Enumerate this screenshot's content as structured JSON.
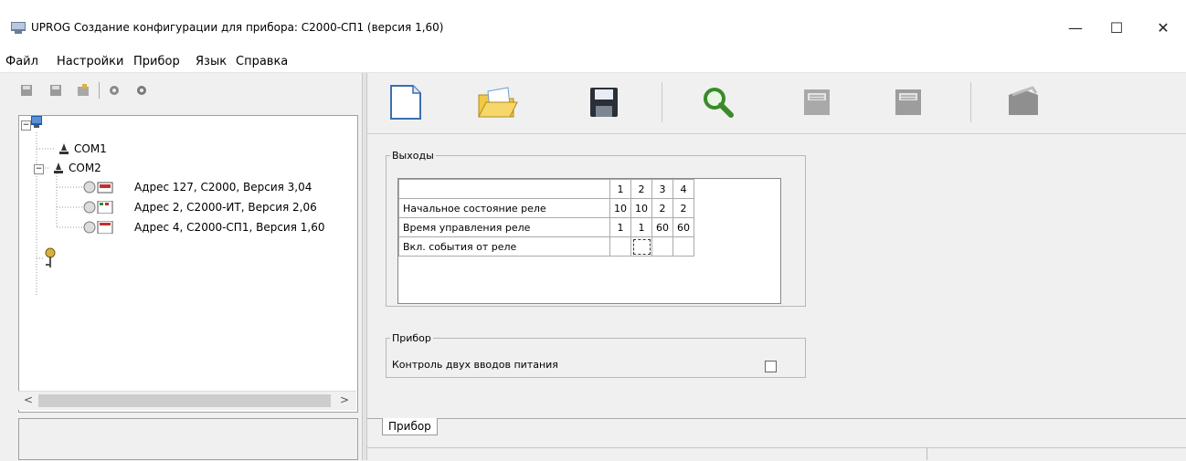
{
  "window": {
    "title": "UPROG  Создание конфигурации для прибора: С2000-СП1 (версия  1,60)",
    "minimize_glyph": "—",
    "maximize_glyph": "☐",
    "close_glyph": "✕"
  },
  "menu": [
    "Файл",
    "Настройки",
    "Прибор",
    "Язык",
    "Справка"
  ],
  "tree": {
    "items": [
      {
        "label": "COM1"
      },
      {
        "label": "COM2"
      },
      {
        "label": "Адрес 127, С2000, Версия 3,04"
      },
      {
        "label": "Адрес 2, С2000-ИТ, Версия 2,06"
      },
      {
        "label": "Адрес 4, С2000-СП1, Версия 1,60"
      }
    ],
    "expander_minus": "−",
    "scroll_left": "<",
    "scroll_right": ">"
  },
  "outputs": {
    "legend": "Выходы",
    "columns": [
      "1",
      "2",
      "3",
      "4"
    ],
    "rows": [
      {
        "label": "Начальное состояние реле",
        "values": [
          "10",
          "10",
          "2",
          "2"
        ]
      },
      {
        "label": "Время управления реле",
        "values": [
          "1",
          "1",
          "60",
          "60"
        ]
      },
      {
        "label": "Вкл. события от реле",
        "values": [
          "",
          "",
          "",
          ""
        ]
      }
    ]
  },
  "device": {
    "legend": "Прибор",
    "dual_power_label": "Контроль двух вводов питания",
    "dual_power_checked": false
  },
  "tabs": [
    {
      "label": "Прибор"
    }
  ],
  "icons": {
    "new": "new-file-icon",
    "open": "open-folder-icon",
    "save": "save-icon",
    "search": "search-icon",
    "read": "read-config-icon",
    "write": "write-config-icon",
    "firmware": "firmware-icon"
  },
  "colors": {
    "accent": "#1e5aa8",
    "search_green": "#3a8a2a",
    "folder_yellow": "#f2c844"
  }
}
